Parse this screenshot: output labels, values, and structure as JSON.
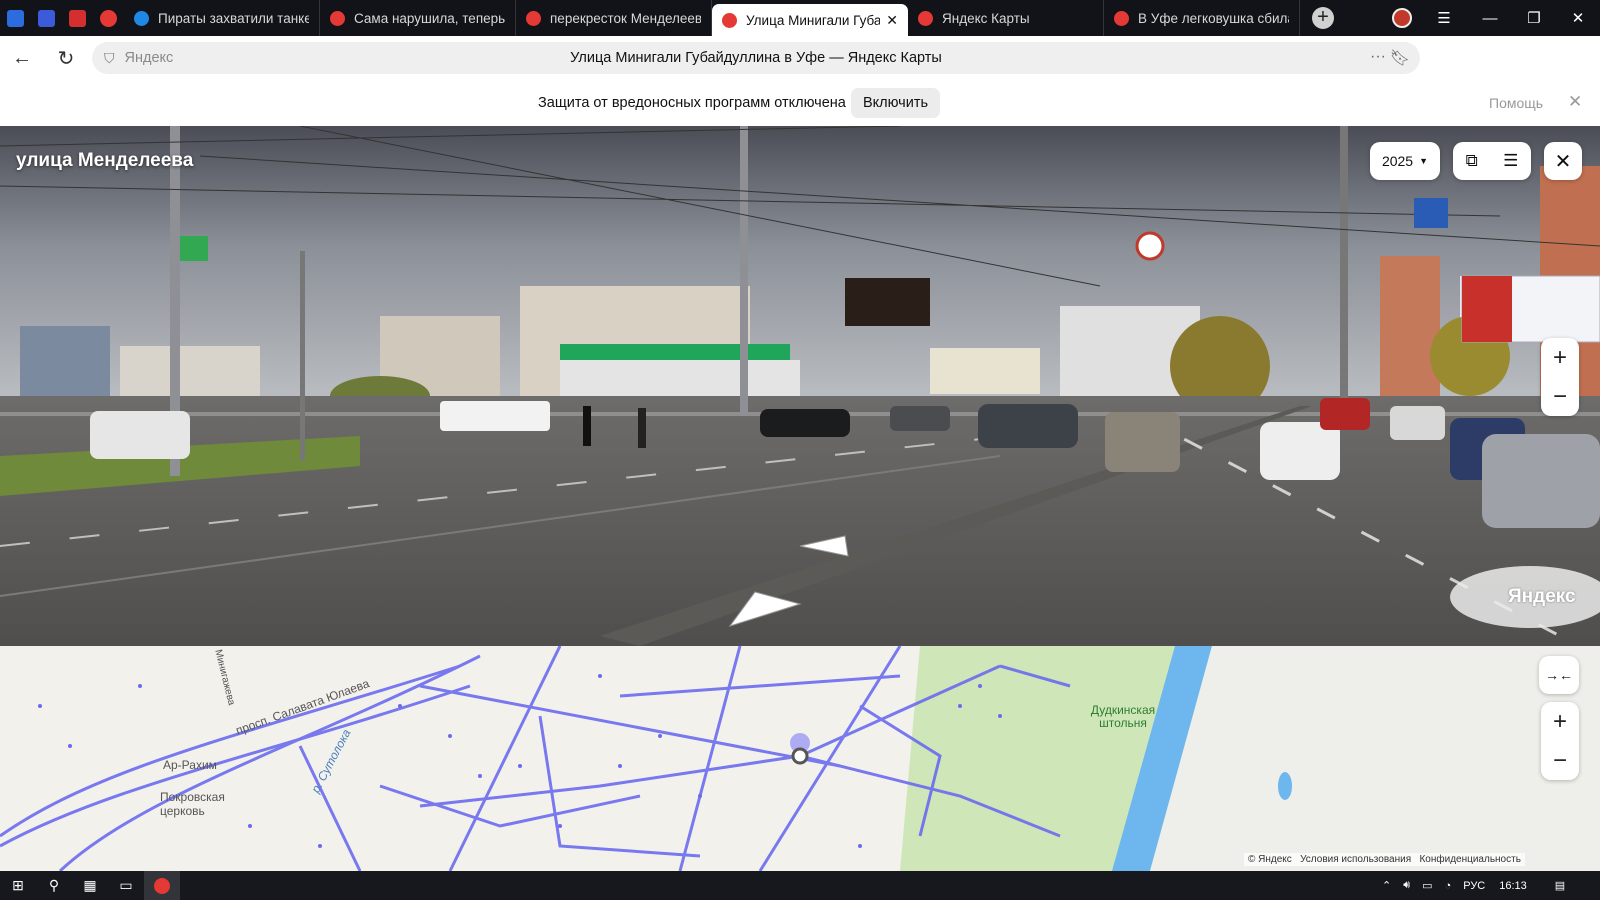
{
  "tabs": [
    {
      "title": "Пираты захватили танке",
      "icon_color": "#1e88e5",
      "active": false
    },
    {
      "title": "Сама нарушила, теперь",
      "icon_color": "#e53935",
      "active": false
    },
    {
      "title": "перекресток Менделеев",
      "icon_color": "#e53935",
      "active": false
    },
    {
      "title": "Улица Минигали Губа",
      "icon_color": "#e53935",
      "active": true
    },
    {
      "title": "Яндекс Карты",
      "icon_color": "#e53935",
      "active": false
    },
    {
      "title": "В Уфе легковушка сбила",
      "icon_color": "#e53935",
      "active": false
    }
  ],
  "pinned_icons": [
    "#2d6cdf",
    "#3b5bdb",
    "#d32f2f",
    "#e53935"
  ],
  "address": {
    "placeholder_brand": "Яндекс",
    "page_title": "Улица Минигали Губайдуллина в Уфе — Яндекс Карты"
  },
  "infobar": {
    "message": "Защита от вредоносных программ отключена",
    "enable_label": "Включить",
    "help_label": "Помощь"
  },
  "panorama": {
    "street_name": "улица Менделеева",
    "year": "2025",
    "watermark": "Яндекс"
  },
  "map": {
    "labels": {
      "avenue": "просп. Салавата Юлаева",
      "street": "Минигажева",
      "river": "р. Сутолока",
      "mosque": "Ар-Рахим",
      "church": "Покровская церковь",
      "shaft": "Дудкинская штольня"
    },
    "copyright": "© Яндекс",
    "terms": "Условия использования",
    "privacy": "Конфиденциальность"
  },
  "taskbar": {
    "lang": "РУС",
    "time": "16:13"
  },
  "colors": {
    "accent_map_line": "#6b6bf0",
    "tabbar_bg": "#121318",
    "shield_green": "#2bb24c"
  }
}
